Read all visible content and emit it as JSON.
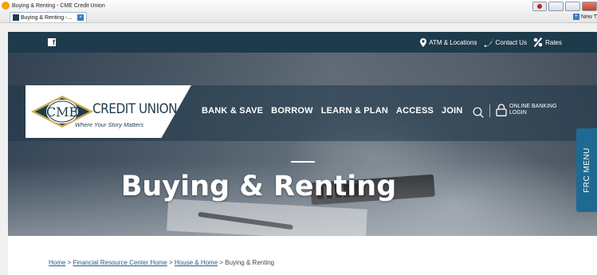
{
  "browser": {
    "window_title": "Buying & Renting - CME Credit Union",
    "tab_label": "Buying & Renting -...",
    "new_tab_label": "New T"
  },
  "utility": {
    "atm": "ATM & Locations",
    "contact": "Contact Us",
    "rates": "Rates"
  },
  "logo": {
    "mark": "CME",
    "name": "CREDIT UNION",
    "tagline": "Where Your Story Matters"
  },
  "nav": {
    "items": [
      "BANK & SAVE",
      "BORROW",
      "LEARN & PLAN",
      "ACCESS",
      "JOIN"
    ],
    "online_banking_line1": "ONLINE BANKING",
    "online_banking_line2": "LOGIN"
  },
  "hero": {
    "title": "Buying & Renting"
  },
  "frc_tab": "FRC MENU",
  "breadcrumb": {
    "home": "Home",
    "sep": ">",
    "frc_home": "Financial Resource Center Home",
    "house_home": "House & Home",
    "current": "Buying & Renting"
  },
  "colors": {
    "navy": "#1e3b4c",
    "tab_blue": "#1f6a93",
    "link_blue": "#1d5f86"
  }
}
